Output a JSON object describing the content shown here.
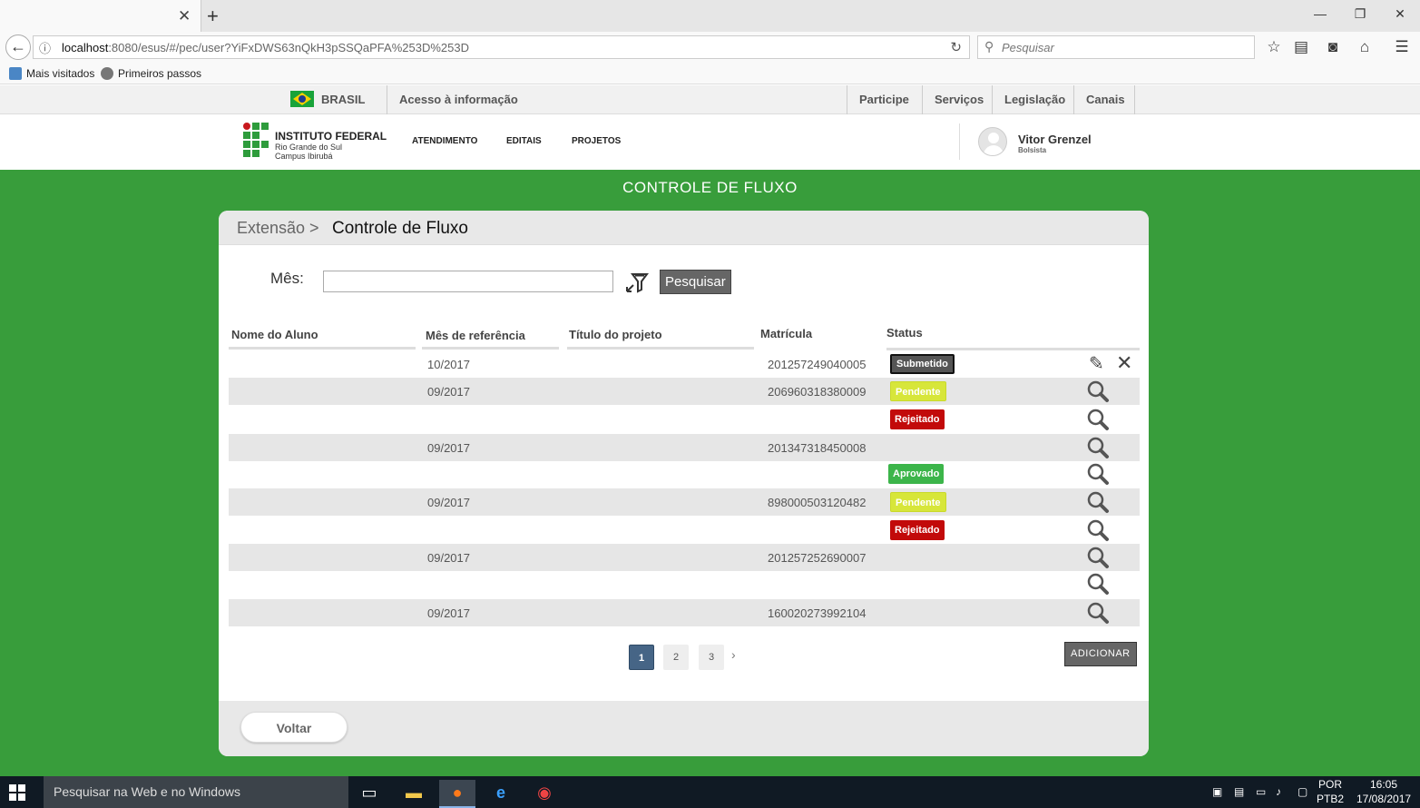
{
  "browser": {
    "tab_close": "✕",
    "new_tab": "+",
    "url_host": "localhost",
    "url_rest": ":8080/esus/#/pec/user?YiFxDWS63nQkH3pSSQaPFA%253D%253D",
    "search_placeholder": "Pesquisar",
    "bookmarks": [
      "Mais visitados",
      "Primeiros passos"
    ]
  },
  "gov_bar": {
    "country": "BRASIL",
    "access": "Acesso à informação",
    "links": [
      "Participe",
      "Serviços",
      "Legislação",
      "Canais"
    ]
  },
  "site": {
    "logo_title": "INSTITUTO FEDERAL",
    "logo_sub1": "Rio Grande do Sul",
    "logo_sub2": "Campus Ibirubá",
    "nav": [
      "ATENDIMENTO",
      "EDITAIS",
      "PROJETOS"
    ],
    "user_name": "Vitor Grenzel",
    "user_role": "Bolsista"
  },
  "page": {
    "title": "CONTROLE DE FLUXO",
    "breadcrumb_prev": "Extensão >",
    "breadcrumb_current": "Controle de Fluxo",
    "filter_label": "Mês:",
    "filter_value": "",
    "search_button": "Pesquisar",
    "columns": [
      "Nome do Aluno",
      "Mês de referência",
      "Título do projeto",
      "Matrícula",
      "Status"
    ],
    "rows": [
      {
        "aluno": "",
        "mes": "10/2017",
        "titulo": "",
        "matricula": "201257249040005",
        "status": "Submetido",
        "actions": "edit-delete"
      },
      {
        "aluno": "",
        "mes": "09/2017",
        "titulo": "",
        "matricula": "206960318380009",
        "status": "Pendente",
        "actions": "view"
      },
      {
        "aluno": "",
        "mes": "",
        "titulo": "",
        "matricula": "",
        "status": "Rejeitado",
        "actions": "view"
      },
      {
        "aluno": "",
        "mes": "09/2017",
        "titulo": "",
        "matricula": "201347318450008",
        "status": "",
        "actions": "view"
      },
      {
        "aluno": "",
        "mes": "",
        "titulo": "",
        "matricula": "",
        "status": "Aprovado",
        "actions": "view"
      },
      {
        "aluno": "",
        "mes": "09/2017",
        "titulo": "",
        "matricula": "898000503120482",
        "status": "Pendente",
        "actions": "view"
      },
      {
        "aluno": "",
        "mes": "",
        "titulo": "",
        "matricula": "",
        "status": "Rejeitado",
        "actions": "view"
      },
      {
        "aluno": "",
        "mes": "09/2017",
        "titulo": "",
        "matricula": "201257252690007",
        "status": "",
        "actions": "view"
      },
      {
        "aluno": "",
        "mes": "",
        "titulo": "",
        "matricula": "",
        "status": "",
        "actions": "view"
      },
      {
        "aluno": "",
        "mes": "09/2017",
        "titulo": "",
        "matricula": "160020273992104",
        "status": "",
        "actions": "view"
      }
    ],
    "pages": [
      "1",
      "2",
      "3"
    ],
    "current_page": "1",
    "add_button": "ADICIONAR",
    "back_button": "Voltar"
  },
  "taskbar": {
    "search_text": "Pesquisar na Web e no Windows",
    "lang1": "POR",
    "lang2": "PTB2",
    "time": "16:05",
    "date": "17/08/2017"
  },
  "colors": {
    "green": "#389d3b",
    "pendente": "#d7e63a",
    "rejeitado": "#c20a0a",
    "aprovado": "#3cb54a",
    "submetido": "#555555",
    "pager_active": "#466586"
  }
}
